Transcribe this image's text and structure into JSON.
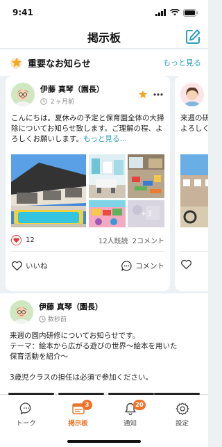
{
  "status": {
    "time": "9:41"
  },
  "header": {
    "title": "掲示板"
  },
  "important": {
    "title": "重要なお知らせ",
    "more_label": "もっと見る"
  },
  "card1": {
    "author": "伊藤 真琴（園長）",
    "time": "２ヶ月前",
    "body": "こんにちは。夏休みの予定と保育園全体の大掃除についてお知らせ致します。ご理解の程、よろしくお願いします。",
    "read_more": "もっと見る...",
    "photo_more": "+3",
    "likes": "12",
    "read_count": "12人既読",
    "comments": "2コメント",
    "like_label": "いいね",
    "comment_label": "コメント"
  },
  "card2_peek": {
    "body": "来週の研\nよろしく"
  },
  "post2": {
    "author": "伊藤 真琴（園長）",
    "time": "数秒前",
    "lines": [
      "来週の園内研修についてお知らせです。",
      "テーマ：絵本から広がる遊びの世界〜絵本を用いた",
      "保育活動を紹介〜",
      "",
      "3歳児クラスの担任は必須で参加ください。"
    ]
  },
  "tabs": [
    {
      "label": "トーク",
      "icon": "chat-icon",
      "badge": ""
    },
    {
      "label": "掲示板",
      "icon": "board-icon",
      "badge": "3"
    },
    {
      "label": "通知",
      "icon": "bell-icon",
      "badge": "20"
    },
    {
      "label": "設定",
      "icon": "gear-icon",
      "badge": ""
    }
  ],
  "colors": {
    "accent": "#2a9fb6",
    "active_tab": "#e8762a",
    "badge": "#f0722a",
    "heart": "#e53935",
    "star": "#f5a623"
  }
}
